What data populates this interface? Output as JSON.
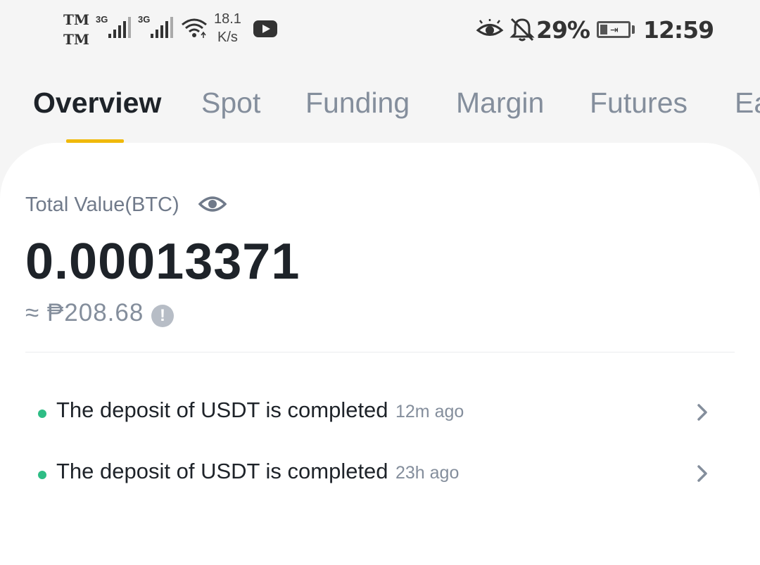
{
  "status_bar": {
    "carrier1": "TM",
    "carrier2": "TM",
    "network1": "3G",
    "network2": "3G",
    "speed_value": "18.1",
    "speed_unit": "K/s",
    "battery_percent": "29%",
    "time": "12:59",
    "icons": [
      "signal-icon",
      "wifi-icon",
      "youtube-icon",
      "eye-icon",
      "bell-off-icon",
      "battery-charging-icon"
    ]
  },
  "tabs": [
    {
      "label": "Overview",
      "active": true
    },
    {
      "label": "Spot"
    },
    {
      "label": "Funding"
    },
    {
      "label": "Margin"
    },
    {
      "label": "Futures"
    },
    {
      "label": "Ea"
    }
  ],
  "summary": {
    "total_label": "Total Value(BTC)",
    "btc_value": "0.00013371",
    "fiat_approx": "≈ ₱208.68"
  },
  "notifications": [
    {
      "text": "The deposit of USDT is completed",
      "time": "12m ago"
    },
    {
      "text": "The deposit of USDT is completed",
      "time": "23h ago"
    }
  ],
  "colors": {
    "accent": "#f0b90b",
    "success_dot": "#2ebd85",
    "muted_text": "#848e9c",
    "primary_text": "#1e2329"
  }
}
